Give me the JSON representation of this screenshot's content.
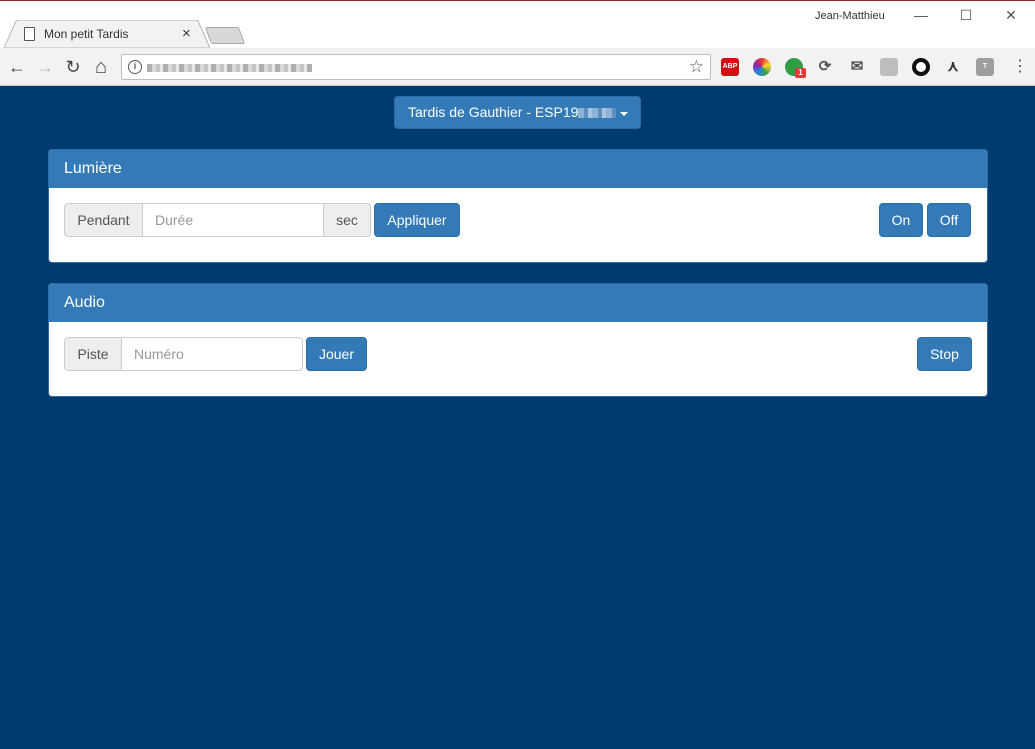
{
  "browser": {
    "tab_title": "Mon petit Tardis",
    "tab_close": "×",
    "user_name": "Jean-Matthieu",
    "window_controls": {
      "minimize": "—",
      "maximize": "☐",
      "close": "✕"
    },
    "nav": {
      "back": "←",
      "forward": "→",
      "reload": "↻",
      "home": "⌂"
    },
    "extensions": [
      {
        "name": "adblock-icon",
        "label": "ABP",
        "color": "#d40d12"
      },
      {
        "name": "colorwheel-icon",
        "label": "",
        "color": "#3aa757"
      },
      {
        "name": "green-ext-icon",
        "label": "1",
        "color": "#2e9e44"
      },
      {
        "name": "sync-icon",
        "label": "",
        "color": "#555555"
      },
      {
        "name": "mail-icon",
        "label": "",
        "color": "#555555"
      },
      {
        "name": "doc-ext-icon",
        "label": "",
        "color": "#bdbdbd"
      },
      {
        "name": "circle-ext-icon",
        "label": "",
        "color": "#111111"
      },
      {
        "name": "graph-ext-icon",
        "label": "",
        "color": "#333333"
      },
      {
        "name": "t-ext-icon",
        "label": "T",
        "color": "#9e9e9e"
      }
    ]
  },
  "device_select": {
    "label": "Tardis de Gauthier - ESP19"
  },
  "lumiere": {
    "title": "Lumière",
    "prefix": "Pendant",
    "duration_placeholder": "Durée",
    "suffix": "sec",
    "apply_label": "Appliquer",
    "on_label": "On",
    "off_label": "Off"
  },
  "audio": {
    "title": "Audio",
    "prefix": "Piste",
    "track_placeholder": "Numéro",
    "play_label": "Jouer",
    "stop_label": "Stop"
  }
}
